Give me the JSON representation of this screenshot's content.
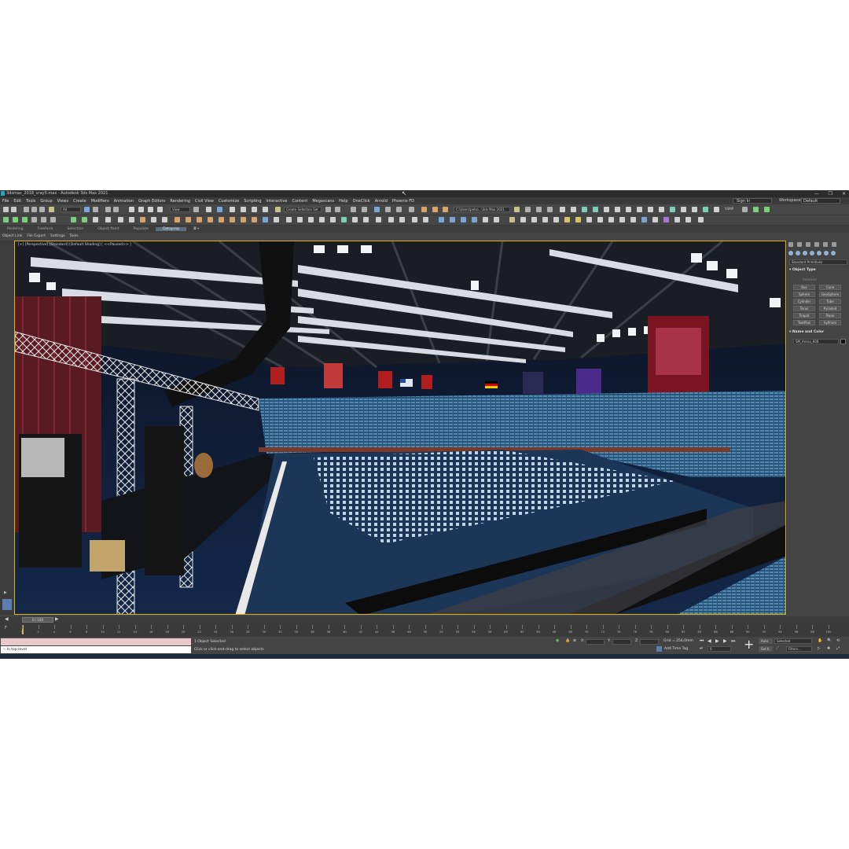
{
  "window": {
    "title": "3dsmax_2018_vray5.max - Autodesk 3ds Max 2021",
    "controls": [
      "—",
      "❐",
      "✕"
    ]
  },
  "menu": [
    "File",
    "Edit",
    "Tools",
    "Group",
    "Views",
    "Create",
    "Modifiers",
    "Animation",
    "Graph Editors",
    "Rendering",
    "Civil View",
    "Customize",
    "Scripting",
    "Interactive",
    "Content",
    "Megascans",
    "Help",
    "OneClick",
    "Arnold",
    "Phoenix FD"
  ],
  "account": {
    "signin": "Sign In",
    "workspaces_label": "Workspaces:",
    "workspace": "Default"
  },
  "toolbar": {
    "filter": "All",
    "view": "View",
    "selection_set": "Create Selection Set",
    "path": "C:\\Users\\petro...\\3ds Max 2021",
    "xsmp": "XSMP"
  },
  "ribbon": {
    "tabs": [
      "Modeling",
      "Freeform",
      "Selection",
      "Object Paint",
      "Populate",
      "Dataprep"
    ],
    "active": "Dataprep"
  },
  "subtabs": [
    "Object Link",
    "File Export",
    "Settings",
    "Tools"
  ],
  "viewport": {
    "label": "[+] [Perspective] [Standard] [Default Shading]  [ <<Paused>> ]",
    "flag_colors": [
      "#000000",
      "#dd0000",
      "#ffce00"
    ]
  },
  "command_panel": {
    "dropdown": "Standard Primitives",
    "object_type_title": "▾ Object Type",
    "autogrid": "AutoGrid",
    "primitives": [
      "Box",
      "Cone",
      "Sphere",
      "GeoSphere",
      "Cylinder",
      "Tube",
      "Torus",
      "Pyramid",
      "Teapot",
      "Plane",
      "TextPlus",
      "hyPrism"
    ],
    "name_color_title": "▾ Name and Color",
    "object_name": "SM_Arena_608"
  },
  "timeline": {
    "thumb": "0 / 100",
    "ticks": [
      "0",
      "2",
      "4",
      "6",
      "8",
      "10",
      "12",
      "14",
      "16",
      "18",
      "20",
      "22",
      "24",
      "26",
      "28",
      "30",
      "32",
      "34",
      "36",
      "38",
      "40",
      "42",
      "44",
      "46",
      "48",
      "50",
      "52",
      "54",
      "56",
      "58",
      "60",
      "62",
      "64",
      "66",
      "68",
      "70",
      "72",
      "74",
      "76",
      "78",
      "80",
      "82",
      "84",
      "86",
      "88",
      "90",
      "92",
      "94",
      "96",
      "98",
      "100"
    ]
  },
  "status": {
    "script_output": "-- In top-level",
    "selected": "1 Object Selected",
    "hint": "Click or click-and-drag to select objects",
    "grid": "Grid = 254,0mm",
    "add_time_tag": "Add Time Tag",
    "x_field": "X:",
    "y_field": "Y:",
    "z_field": "Z:",
    "auto": "Auto",
    "selected_dropdown": "Selected",
    "setk": "Set K.",
    "filters": "Filters...",
    "frame": "0"
  }
}
